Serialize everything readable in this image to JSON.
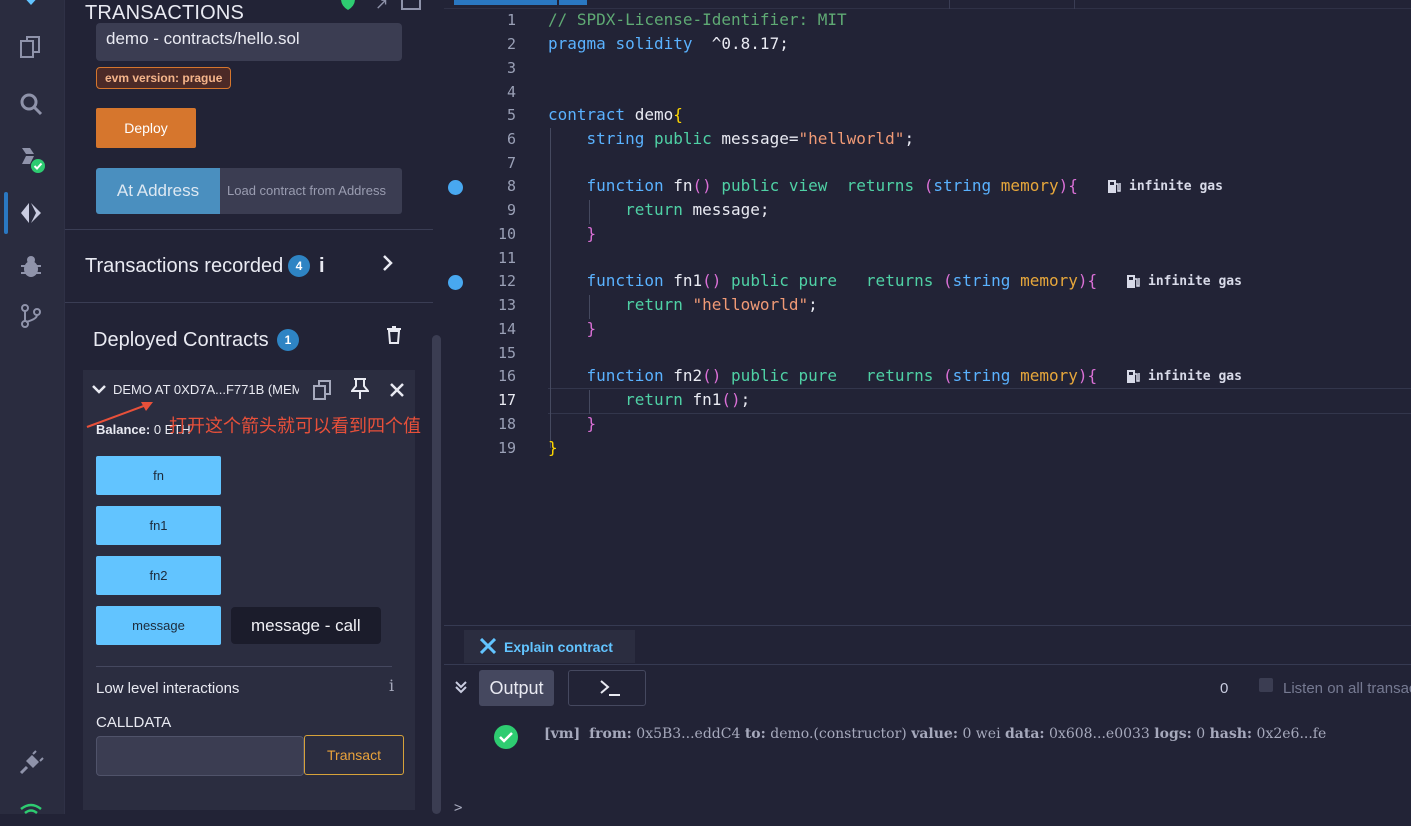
{
  "sidebar": {
    "items": [
      {
        "name": "file-explorer"
      },
      {
        "name": "search"
      },
      {
        "name": "solidity-compiler"
      },
      {
        "name": "deploy-run"
      },
      {
        "name": "debugger"
      },
      {
        "name": "git"
      },
      {
        "name": "plugin-manager"
      },
      {
        "name": "network"
      }
    ]
  },
  "panel": {
    "header": "TRANSACTIONS",
    "contract_select": "demo - contracts/hello.sol",
    "evm_badge": "evm version: prague",
    "deploy_label": "Deploy",
    "at_address_label": "At Address",
    "load_contract_placeholder": "Load contract from Address",
    "transactions_recorded_label": "Transactions recorded",
    "transactions_recorded_count": "4",
    "info_glyph": "i",
    "deployed_contracts_label": "Deployed Contracts",
    "deployed_contracts_count": "1",
    "instance_title": "DEMO AT 0XD7A...F771B (MEM",
    "annotation": "打开这个箭头就可以看到四个值",
    "balance_label": "Balance:",
    "balance_value": "0 ETH",
    "functions": [
      "fn",
      "fn1",
      "fn2",
      "message"
    ],
    "tooltip": "message - call",
    "low_level_label": "Low level interactions",
    "calldata_label": "CALLDATA",
    "transact_label": "Transact"
  },
  "editor": {
    "gas_text": "infinite gas",
    "active_line": 17,
    "breakpoint_lines": [
      8,
      12
    ]
  },
  "terminal": {
    "explain_label": "Explain contract",
    "output_label": "Output",
    "count": "0",
    "listen_label": "Listen on all transactions",
    "log": {
      "tag": "[vm]",
      "from_label": "from:",
      "from_value": "0x5B3...eddC4",
      "to_label": "to:",
      "to_value": "demo.(constructor)",
      "value_label": "value:",
      "value_value": "0 wei",
      "data_label": "data:",
      "data_value": "0x608...e0033",
      "logs_label": "logs:",
      "logs_value": "0",
      "hash_label": "hash:",
      "hash_value": "0x2e6...fe"
    },
    "prompt": ">"
  },
  "colors": {
    "accent": "#62c4ff",
    "deploy": "#d6762d",
    "badge": "#2e84c4",
    "success": "#2ecc71"
  }
}
